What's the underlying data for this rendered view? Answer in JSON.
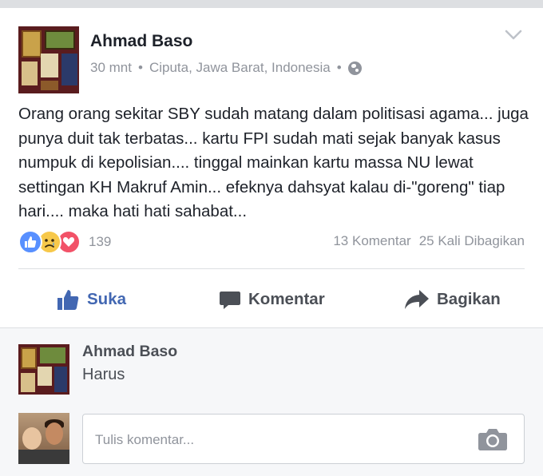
{
  "post": {
    "author": "Ahmad Baso",
    "time": "30 mnt",
    "separator1": "•",
    "location": "Ciputa, Jawa Barat, Indonesia",
    "separator2": "•",
    "privacy_icon": "globe-icon",
    "text": "Orang orang sekitar SBY sudah matang dalam politisasi agama... juga punya duit tak terbatas... kartu FPI sudah mati sejak banyak kasus numpuk di kepolisian.... tinggal mainkan kartu massa NU lewat settingan KH Makruf Amin... efeknya dahsyat kalau di-\"goreng\" tiap hari.... maka hati hati sahabat...",
    "reactions": {
      "icons": [
        "like-reaction-icon",
        "sad-reaction-icon",
        "love-reaction-icon"
      ],
      "count": "139"
    },
    "comment_count": "13 Komentar",
    "share_count": "25 Kali Dibagikan"
  },
  "actions": {
    "like_label": "Suka",
    "comment_label": "Komentar",
    "share_label": "Bagikan"
  },
  "comments": [
    {
      "author": "Ahmad Baso",
      "text": "Harus"
    }
  ],
  "composer": {
    "placeholder": "Tulis komentar..."
  },
  "colors": {
    "accent": "#4267b2",
    "meta_text": "#90949c",
    "like_reaction": "#5890ff",
    "love_reaction": "#f25268",
    "sad_reaction": "#f7c84a"
  }
}
